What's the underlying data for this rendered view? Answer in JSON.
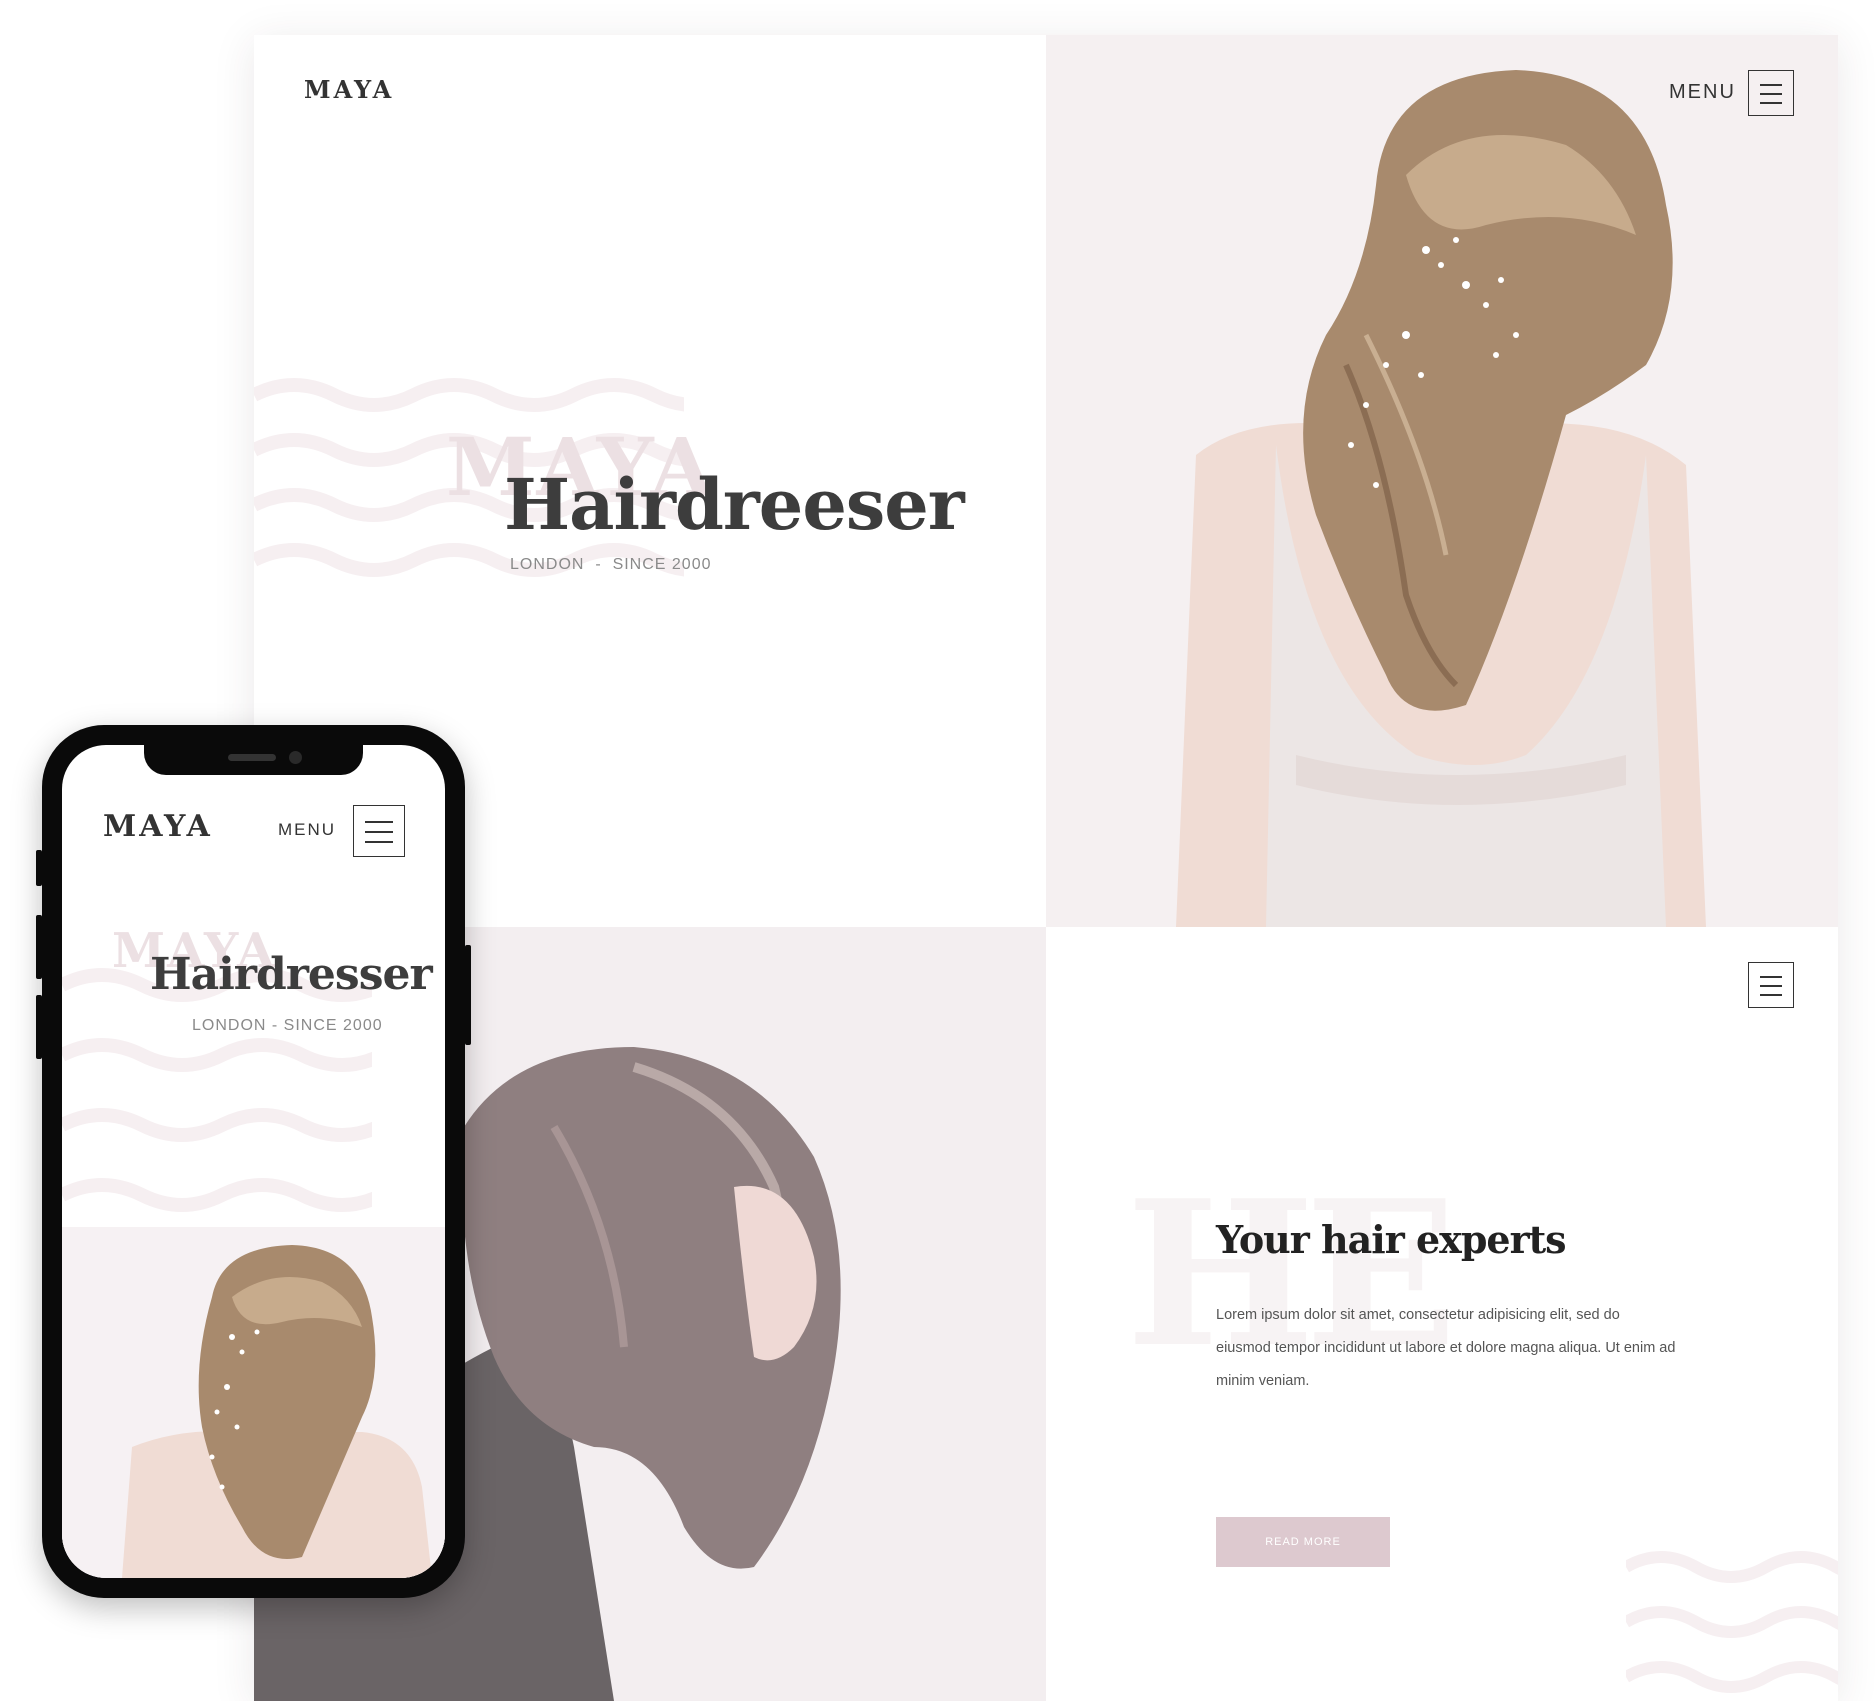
{
  "desktop": {
    "logo": "MAYA",
    "menu_label": "MENU",
    "hero": {
      "ghost_text": "MAYA",
      "title": "Hairdreeser",
      "subtitle": "LONDON  -  SINCE 2000"
    },
    "about": {
      "ghost_text": "HE",
      "title": "Your hair experts",
      "body": "Lorem ipsum dolor sit amet, consectetur adipisicing elit, sed do eiusmod tempor incididunt ut labore et dolore magna aliqua. Ut enim ad minim veniam.",
      "button_label": "READ MORE"
    }
  },
  "mobile": {
    "logo": "MAYA",
    "menu_label": "MENU",
    "hero": {
      "ghost_text": "MAYA",
      "title": "Hairdresser",
      "subtitle": "LONDON - SINCE 2000"
    }
  },
  "colors": {
    "accent": "#ddc9cf",
    "text_dark": "#3d3d3d",
    "ghost": "#ece0e3",
    "photo_bg": "#f5f0f1"
  },
  "icons": [
    "hamburger-menu-icon"
  ]
}
